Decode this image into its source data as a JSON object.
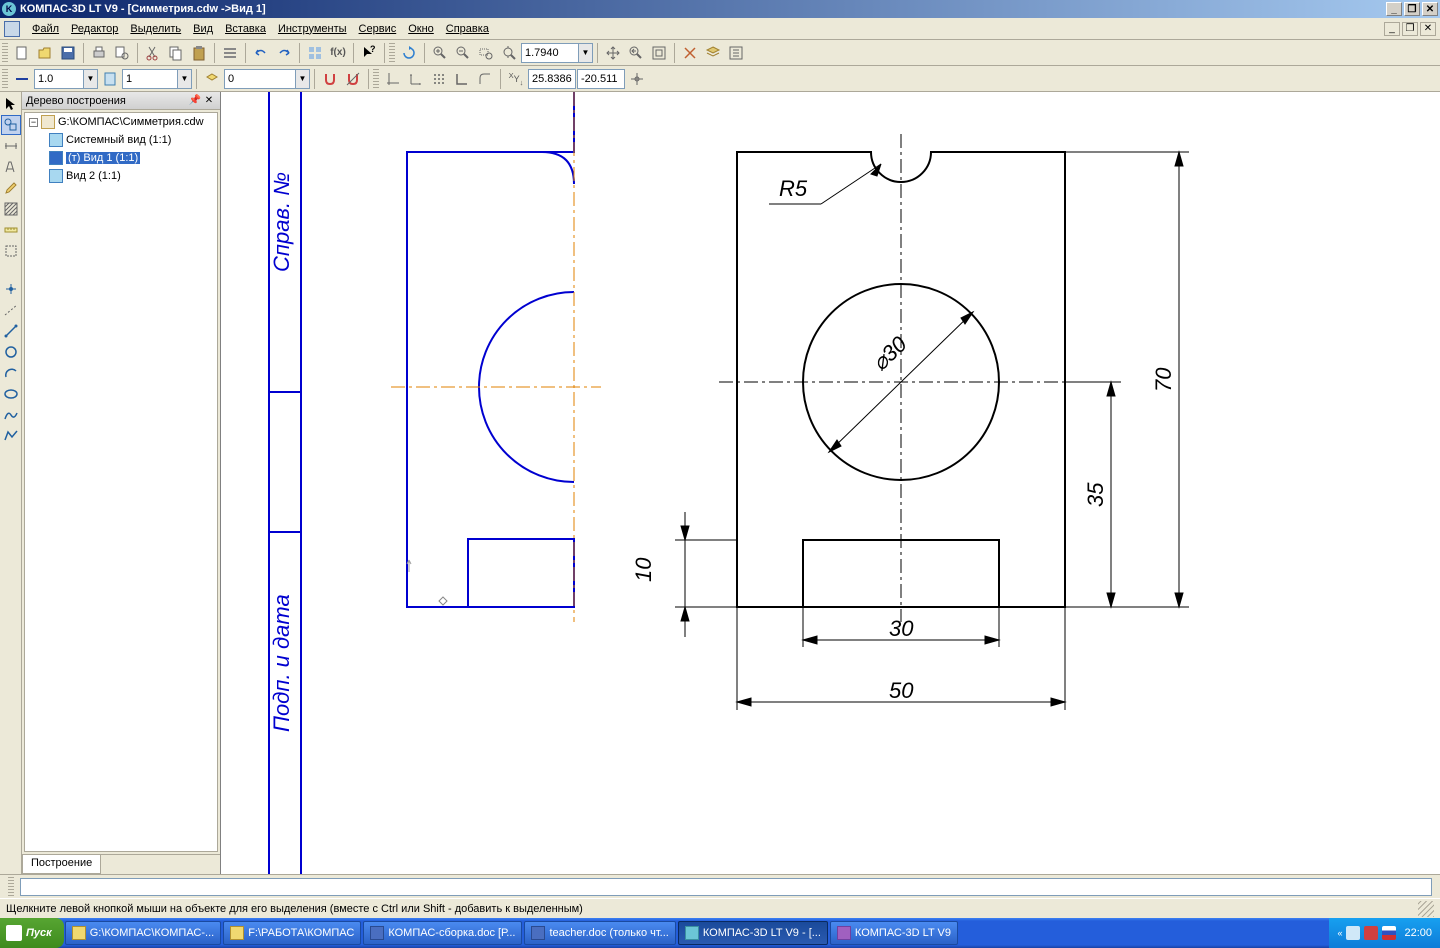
{
  "titlebar": {
    "app_icon_letter": "K",
    "title": "КОМПАС-3D LT V9 - [Симметрия.cdw ->Вид 1]"
  },
  "menu": {
    "items": [
      "Файл",
      "Редактор",
      "Выделить",
      "Вид",
      "Вставка",
      "Инструменты",
      "Сервис",
      "Окно",
      "Справка"
    ]
  },
  "toolbar1": {
    "zoom": "1.7940"
  },
  "toolbar2": {
    "combo1": "1.0",
    "combo2": "1",
    "combo3": "0",
    "x": "25.8386",
    "y": "-20.511"
  },
  "tree": {
    "title": "Дерево построения",
    "root": "G:\\КОМПАС\\Симметрия.cdw",
    "items": [
      "Системный вид (1:1)",
      "(т) Вид 1 (1:1)",
      "Вид 2 (1:1)"
    ],
    "tab": "Построение"
  },
  "drawing": {
    "left_labels": {
      "top": "Справ. №",
      "bottom": "Подп. и дата"
    },
    "dims": {
      "r5": "R5",
      "d30": "⌀30",
      "h70": "70",
      "h35": "35",
      "h10": "10",
      "w30": "30",
      "w50": "50"
    }
  },
  "status": {
    "hint": "Щелкните левой кнопкой мыши на объекте для его выделения (вместе с Ctrl или Shift - добавить к выделенным)"
  },
  "taskbar": {
    "start": "Пуск",
    "tasks": [
      "G:\\КОМПАС\\КОМПАС-...",
      "F:\\РАБОТА\\КОМПАС",
      "КОМПАС-сборка.doc [Р...",
      "teacher.doc (только чт...",
      "КОМПАС-3D LT V9 - [...",
      "КОМПАС-3D LT V9"
    ],
    "active_task": 4,
    "clock": "22:00"
  }
}
